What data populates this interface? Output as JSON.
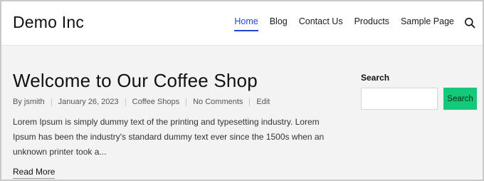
{
  "header": {
    "site_title": "Demo Inc",
    "nav": [
      {
        "label": "Home",
        "active": true
      },
      {
        "label": "Blog"
      },
      {
        "label": "Contact Us"
      },
      {
        "label": "Products"
      },
      {
        "label": "Sample Page"
      }
    ],
    "search_icon": "search-icon",
    "accent_color": "#2346d8"
  },
  "post": {
    "title": "Welcome to Our Coffee Shop",
    "author": "By jsmith",
    "date": "January 26, 2023",
    "category": "Coffee Shops",
    "comments": "No Comments",
    "edit": "Edit",
    "excerpt": "Lorem Ipsum is simply dummy text of the printing and typesetting industry. Lorem Ipsum has been the industry's standard dummy text ever since the 1500s when an unknown printer took a...",
    "read_more": "Read More"
  },
  "sidebar": {
    "search_title": "Search",
    "search_value": "",
    "search_button": "Search",
    "button_color": "#14c97a"
  }
}
